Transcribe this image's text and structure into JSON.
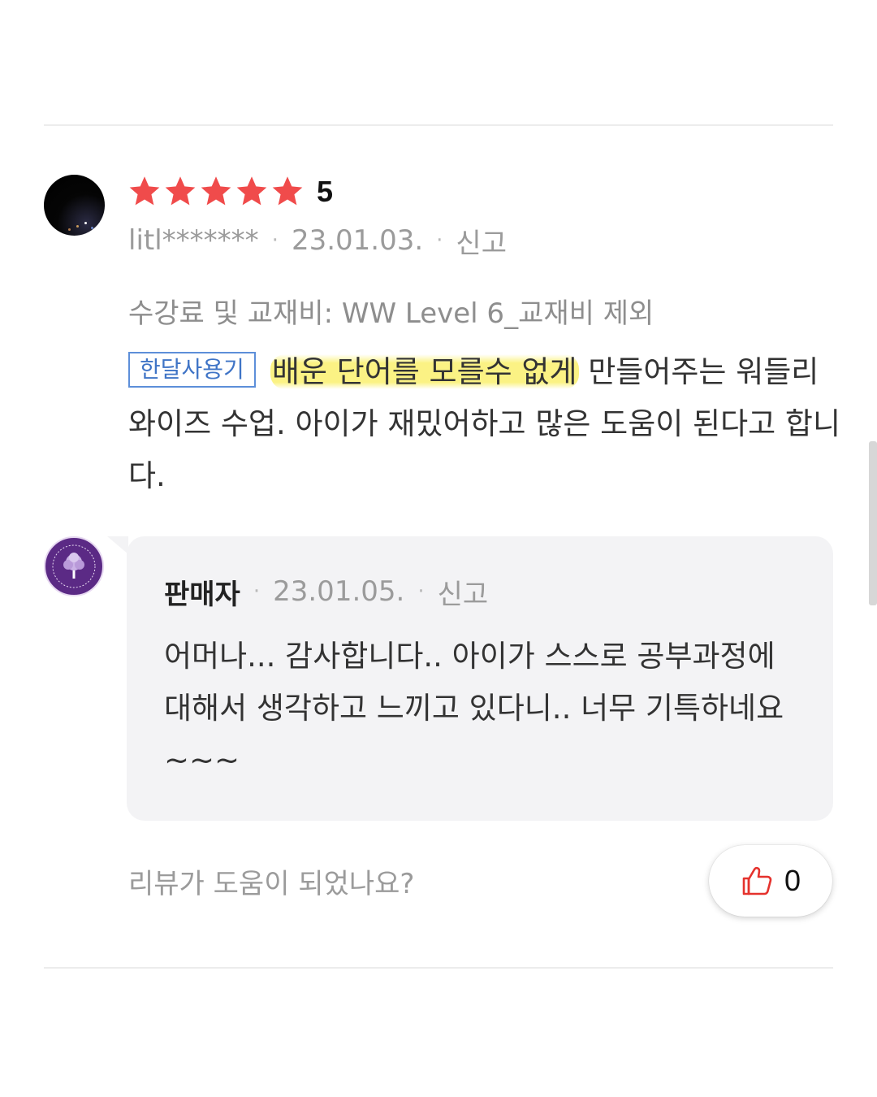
{
  "review": {
    "rating_value": "5",
    "stars_filled": 5,
    "stars_total": 5,
    "user": "litl*******",
    "separator": "·",
    "date": "23.01.03.",
    "report_label": "신고",
    "option": "수강료 및 교재비: WW Level 6_교재비 제외",
    "badge": "한달사용기",
    "body_highlight": "배운 단어를 모를수 없게",
    "body_rest": " 만들어주는 워들리와이즈 수업. 아이가 재밌어하고 많은 도움이 된다고 합니다."
  },
  "reply": {
    "author": "판매자",
    "separator": "·",
    "date": "23.01.05.",
    "report_label": "신고",
    "text": "어머나... 감사합니다.. 아이가 스스로 공부과정에 대해서 생각하고 느끼고 있다니.. 너무 기특하네요~~~"
  },
  "helpful": {
    "question": "리뷰가 도움이 되었나요?",
    "count": "0"
  },
  "colors": {
    "star": "#f04b4b",
    "badge_border": "#5d8fd9",
    "highlight": "#faf06e",
    "thumb_icon": "#e5322d",
    "bubble_bg": "#f3f3f5"
  },
  "icons": {
    "star": "star-icon",
    "like": "thumbs-up-icon"
  }
}
